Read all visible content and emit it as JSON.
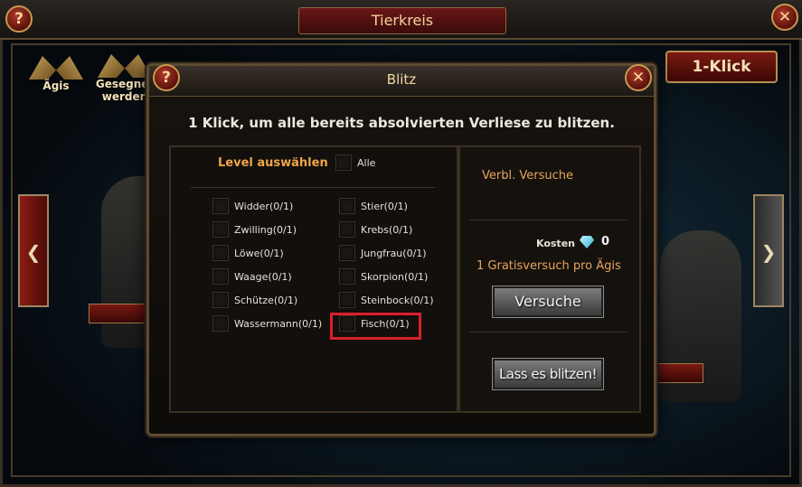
{
  "window": {
    "title": "Tierkreis",
    "help_glyph": "?",
    "close_glyph": "✕"
  },
  "left_emblems": [
    {
      "label": "Ägis"
    },
    {
      "label": "Gesegnet werden"
    }
  ],
  "one_klick_label": "1-Klick",
  "dialog": {
    "title": "Blitz",
    "help_glyph": "?",
    "close_glyph": "✕",
    "subtitle": "1 Klick, um alle bereits absolvierten Verliese zu blitzen.",
    "level_select_label": "Level auswählen",
    "all_label": "Alle",
    "levels": [
      {
        "label": "Widder(0/1)"
      },
      {
        "label": "Stier(0/1)"
      },
      {
        "label": "Zwilling(0/1)"
      },
      {
        "label": "Krebs(0/1)"
      },
      {
        "label": "Löwe(0/1)"
      },
      {
        "label": "Jungfrau(0/1)"
      },
      {
        "label": "Waage(0/1)"
      },
      {
        "label": "Skorpion(0/1)"
      },
      {
        "label": "Schütze(0/1)"
      },
      {
        "label": "Steinbock(0/1)"
      },
      {
        "label": "Wassermann(0/1)"
      },
      {
        "label": "Fisch(0/1)"
      }
    ],
    "remaining_attempts_label": "Verbl. Versuche",
    "cost_label": "Kosten",
    "cost_value": "0",
    "free_attempt_text": "1 Gratisversuch pro Ägis",
    "try_button": "Versuche",
    "blitz_button": "Lass es blitzen!"
  },
  "colors": {
    "accent_orange": "#f0a64a",
    "highlight_red": "#d91f2a"
  }
}
